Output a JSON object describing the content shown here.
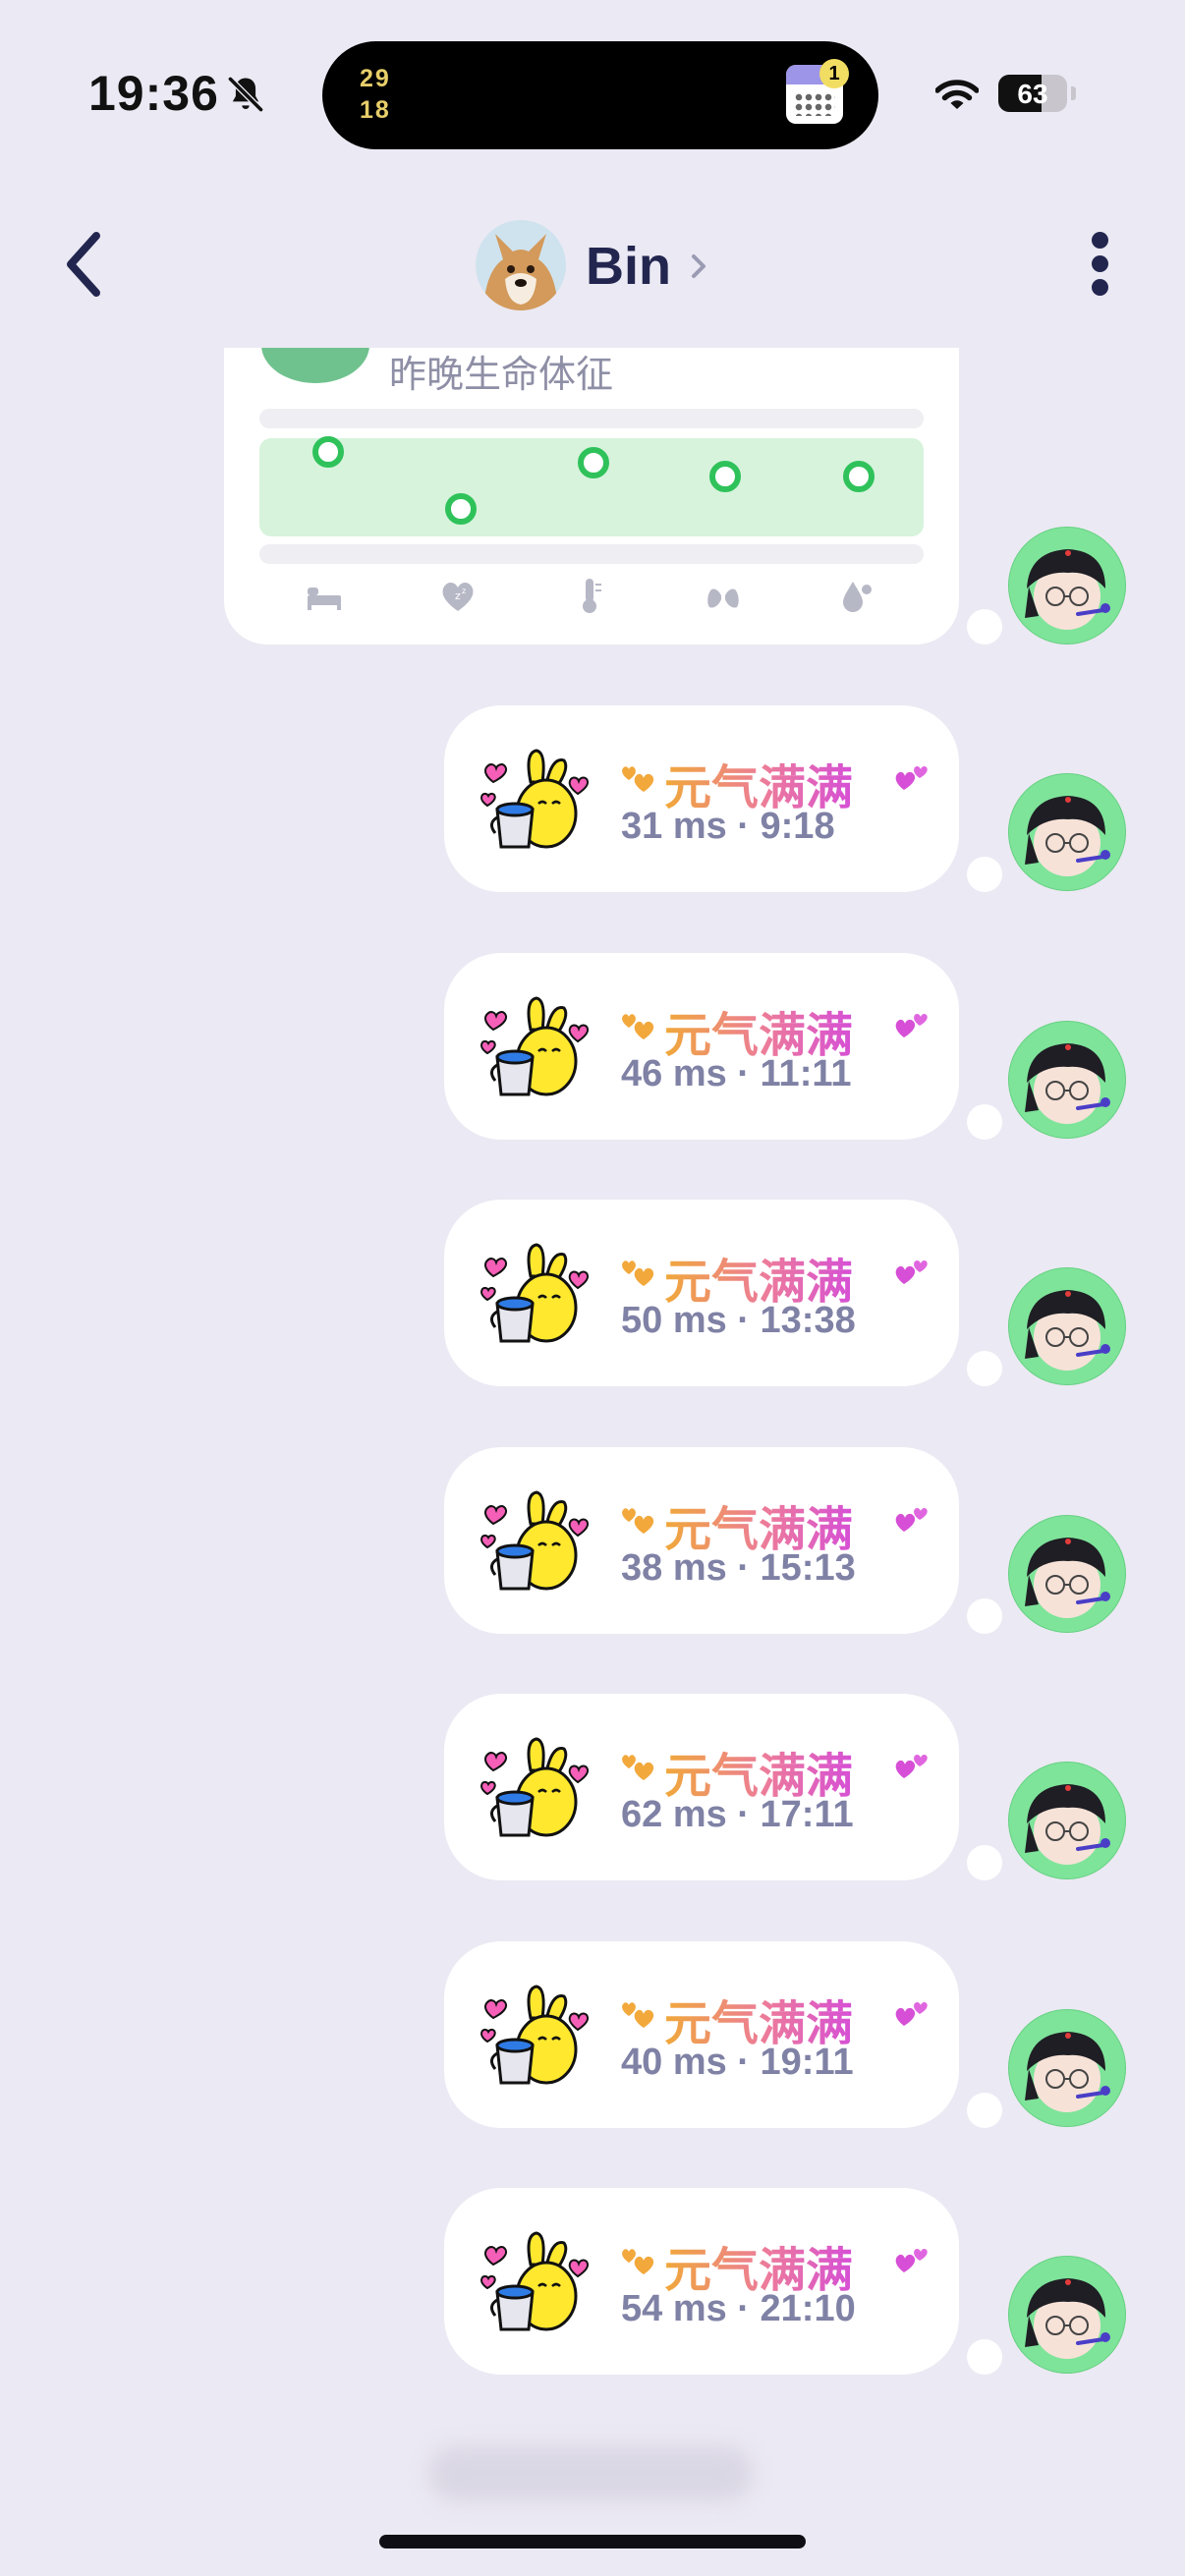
{
  "status_bar": {
    "time": "19:36",
    "island_line1": "29",
    "island_line2": "18",
    "calendar_badge": "1",
    "battery_level": 63,
    "battery_text": "63"
  },
  "nav": {
    "name": "Bin"
  },
  "vitals_card": {
    "title": "昨晚生命体征",
    "accent_color": "#2FC25A",
    "band_color": "#D7F3DC",
    "icons": [
      "bed-icon",
      "heart-zzz-icon",
      "thermometer-icon",
      "lungs-icon",
      "drops-icon"
    ]
  },
  "messages": [
    {
      "title": "元气满满",
      "subtitle": "31 ms · 9:18"
    },
    {
      "title": "元气满满",
      "subtitle": "46 ms · 11:11"
    },
    {
      "title": "元气满满",
      "subtitle": "50 ms · 13:38"
    },
    {
      "title": "元气满满",
      "subtitle": "38 ms · 15:13"
    },
    {
      "title": "元气满满",
      "subtitle": "62 ms · 17:11"
    },
    {
      "title": "元气满满",
      "subtitle": "40 ms · 19:11"
    },
    {
      "title": "元气满满",
      "subtitle": "54 ms · 21:10"
    }
  ],
  "colors": {
    "background": "#EBE9F3",
    "text_primary": "#22264F",
    "subtitle": "#7F81A5",
    "avatar_bg": "#7EE49A"
  }
}
